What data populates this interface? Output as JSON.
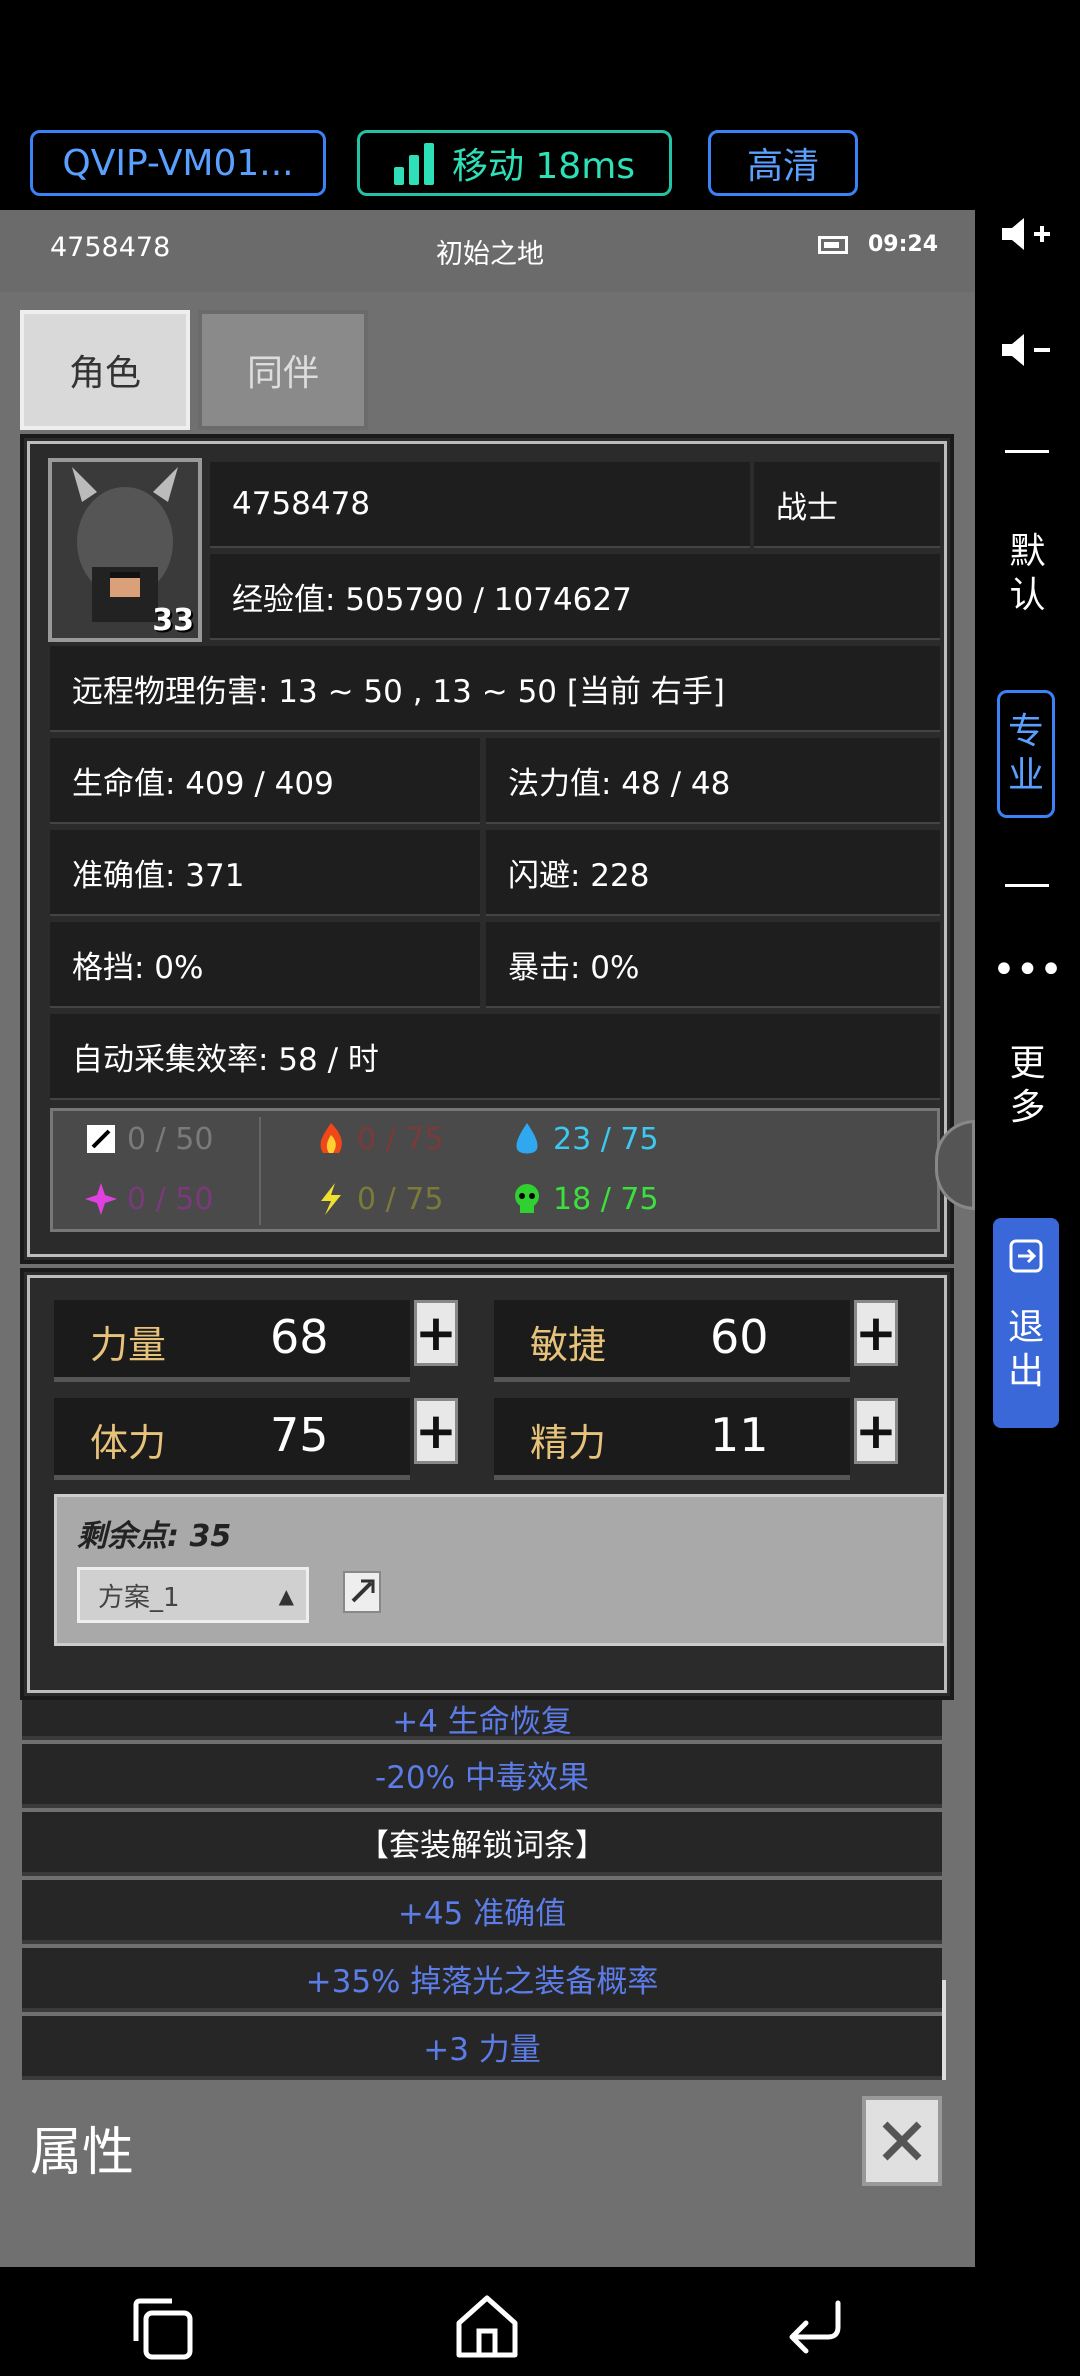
{
  "topbar": {
    "server": "QVIP-VM01...",
    "network": "移动 18ms",
    "quality": "高清"
  },
  "status": {
    "player_id": "4758478",
    "location": "初始之地",
    "time": "09:24"
  },
  "tabs": [
    "角色",
    "同伴"
  ],
  "character": {
    "level": "33",
    "name": "4758478",
    "class": "战士",
    "exp": "经验值: 505790 / 1074627",
    "damage": "远程物理伤害: 13 ~ 50 , 13 ~ 50 [当前 右手]",
    "hp": "生命值: 409 / 409",
    "mp": "法力值: 48 / 48",
    "accuracy": "准确值: 371",
    "dodge": "闪避: 228",
    "block": "格挡: 0%",
    "crit": "暴击: 0%",
    "gather": "自动采集效率: 58 / 时"
  },
  "resources": [
    {
      "icon": "sword-icon",
      "value": "0 / 50",
      "color": "#7a7a7a"
    },
    {
      "icon": "fire-icon",
      "value": "0 / 75",
      "color": "#7a3a3a"
    },
    {
      "icon": "water-drop-icon",
      "value": "23 / 75",
      "color": "#3cc8f0"
    },
    {
      "icon": "magic-star-icon",
      "value": "0 / 50",
      "color": "#7a3a7a"
    },
    {
      "icon": "lightning-icon",
      "value": "0 / 75",
      "color": "#7a7a3a"
    },
    {
      "icon": "poison-skull-icon",
      "value": "18 / 75",
      "color": "#3ce03c"
    }
  ],
  "stats": [
    {
      "name": "力量",
      "value": "68"
    },
    {
      "name": "敏捷",
      "value": "60"
    },
    {
      "name": "体力",
      "value": "75"
    },
    {
      "name": "精力",
      "value": "11"
    }
  ],
  "remaining_points": "剩余点: 35",
  "plan_select": "方案_1",
  "bonus_list": [
    "+4 生命恢复",
    "-20% 中毒效果",
    "【套装解锁词条】",
    "+45 准确值",
    "+35% 掉落光之装备概率",
    "+3 力量"
  ],
  "footer_title": "属性",
  "side": {
    "default": "默\n认",
    "pro": "专\n业",
    "more": "更\n多",
    "exit": "退\n出"
  }
}
